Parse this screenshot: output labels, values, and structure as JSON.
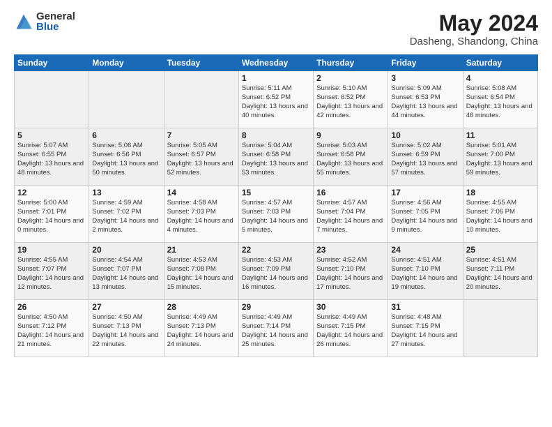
{
  "logo": {
    "general": "General",
    "blue": "Blue"
  },
  "title": "May 2024",
  "subtitle": "Dasheng, Shandong, China",
  "weekdays": [
    "Sunday",
    "Monday",
    "Tuesday",
    "Wednesday",
    "Thursday",
    "Friday",
    "Saturday"
  ],
  "weeks": [
    [
      {
        "day": "",
        "empty": true
      },
      {
        "day": "",
        "empty": true
      },
      {
        "day": "",
        "empty": true
      },
      {
        "day": "1",
        "sunrise": "Sunrise: 5:11 AM",
        "sunset": "Sunset: 6:52 PM",
        "daylight": "Daylight: 13 hours and 40 minutes."
      },
      {
        "day": "2",
        "sunrise": "Sunrise: 5:10 AM",
        "sunset": "Sunset: 6:52 PM",
        "daylight": "Daylight: 13 hours and 42 minutes."
      },
      {
        "day": "3",
        "sunrise": "Sunrise: 5:09 AM",
        "sunset": "Sunset: 6:53 PM",
        "daylight": "Daylight: 13 hours and 44 minutes."
      },
      {
        "day": "4",
        "sunrise": "Sunrise: 5:08 AM",
        "sunset": "Sunset: 6:54 PM",
        "daylight": "Daylight: 13 hours and 46 minutes."
      }
    ],
    [
      {
        "day": "5",
        "sunrise": "Sunrise: 5:07 AM",
        "sunset": "Sunset: 6:55 PM",
        "daylight": "Daylight: 13 hours and 48 minutes."
      },
      {
        "day": "6",
        "sunrise": "Sunrise: 5:06 AM",
        "sunset": "Sunset: 6:56 PM",
        "daylight": "Daylight: 13 hours and 50 minutes."
      },
      {
        "day": "7",
        "sunrise": "Sunrise: 5:05 AM",
        "sunset": "Sunset: 6:57 PM",
        "daylight": "Daylight: 13 hours and 52 minutes."
      },
      {
        "day": "8",
        "sunrise": "Sunrise: 5:04 AM",
        "sunset": "Sunset: 6:58 PM",
        "daylight": "Daylight: 13 hours and 53 minutes."
      },
      {
        "day": "9",
        "sunrise": "Sunrise: 5:03 AM",
        "sunset": "Sunset: 6:58 PM",
        "daylight": "Daylight: 13 hours and 55 minutes."
      },
      {
        "day": "10",
        "sunrise": "Sunrise: 5:02 AM",
        "sunset": "Sunset: 6:59 PM",
        "daylight": "Daylight: 13 hours and 57 minutes."
      },
      {
        "day": "11",
        "sunrise": "Sunrise: 5:01 AM",
        "sunset": "Sunset: 7:00 PM",
        "daylight": "Daylight: 13 hours and 59 minutes."
      }
    ],
    [
      {
        "day": "12",
        "sunrise": "Sunrise: 5:00 AM",
        "sunset": "Sunset: 7:01 PM",
        "daylight": "Daylight: 14 hours and 0 minutes."
      },
      {
        "day": "13",
        "sunrise": "Sunrise: 4:59 AM",
        "sunset": "Sunset: 7:02 PM",
        "daylight": "Daylight: 14 hours and 2 minutes."
      },
      {
        "day": "14",
        "sunrise": "Sunrise: 4:58 AM",
        "sunset": "Sunset: 7:03 PM",
        "daylight": "Daylight: 14 hours and 4 minutes."
      },
      {
        "day": "15",
        "sunrise": "Sunrise: 4:57 AM",
        "sunset": "Sunset: 7:03 PM",
        "daylight": "Daylight: 14 hours and 5 minutes."
      },
      {
        "day": "16",
        "sunrise": "Sunrise: 4:57 AM",
        "sunset": "Sunset: 7:04 PM",
        "daylight": "Daylight: 14 hours and 7 minutes."
      },
      {
        "day": "17",
        "sunrise": "Sunrise: 4:56 AM",
        "sunset": "Sunset: 7:05 PM",
        "daylight": "Daylight: 14 hours and 9 minutes."
      },
      {
        "day": "18",
        "sunrise": "Sunrise: 4:55 AM",
        "sunset": "Sunset: 7:06 PM",
        "daylight": "Daylight: 14 hours and 10 minutes."
      }
    ],
    [
      {
        "day": "19",
        "sunrise": "Sunrise: 4:55 AM",
        "sunset": "Sunset: 7:07 PM",
        "daylight": "Daylight: 14 hours and 12 minutes."
      },
      {
        "day": "20",
        "sunrise": "Sunrise: 4:54 AM",
        "sunset": "Sunset: 7:07 PM",
        "daylight": "Daylight: 14 hours and 13 minutes."
      },
      {
        "day": "21",
        "sunrise": "Sunrise: 4:53 AM",
        "sunset": "Sunset: 7:08 PM",
        "daylight": "Daylight: 14 hours and 15 minutes."
      },
      {
        "day": "22",
        "sunrise": "Sunrise: 4:53 AM",
        "sunset": "Sunset: 7:09 PM",
        "daylight": "Daylight: 14 hours and 16 minutes."
      },
      {
        "day": "23",
        "sunrise": "Sunrise: 4:52 AM",
        "sunset": "Sunset: 7:10 PM",
        "daylight": "Daylight: 14 hours and 17 minutes."
      },
      {
        "day": "24",
        "sunrise": "Sunrise: 4:51 AM",
        "sunset": "Sunset: 7:10 PM",
        "daylight": "Daylight: 14 hours and 19 minutes."
      },
      {
        "day": "25",
        "sunrise": "Sunrise: 4:51 AM",
        "sunset": "Sunset: 7:11 PM",
        "daylight": "Daylight: 14 hours and 20 minutes."
      }
    ],
    [
      {
        "day": "26",
        "sunrise": "Sunrise: 4:50 AM",
        "sunset": "Sunset: 7:12 PM",
        "daylight": "Daylight: 14 hours and 21 minutes."
      },
      {
        "day": "27",
        "sunrise": "Sunrise: 4:50 AM",
        "sunset": "Sunset: 7:13 PM",
        "daylight": "Daylight: 14 hours and 22 minutes."
      },
      {
        "day": "28",
        "sunrise": "Sunrise: 4:49 AM",
        "sunset": "Sunset: 7:13 PM",
        "daylight": "Daylight: 14 hours and 24 minutes."
      },
      {
        "day": "29",
        "sunrise": "Sunrise: 4:49 AM",
        "sunset": "Sunset: 7:14 PM",
        "daylight": "Daylight: 14 hours and 25 minutes."
      },
      {
        "day": "30",
        "sunrise": "Sunrise: 4:49 AM",
        "sunset": "Sunset: 7:15 PM",
        "daylight": "Daylight: 14 hours and 26 minutes."
      },
      {
        "day": "31",
        "sunrise": "Sunrise: 4:48 AM",
        "sunset": "Sunset: 7:15 PM",
        "daylight": "Daylight: 14 hours and 27 minutes."
      },
      {
        "day": "",
        "empty": true
      }
    ]
  ]
}
